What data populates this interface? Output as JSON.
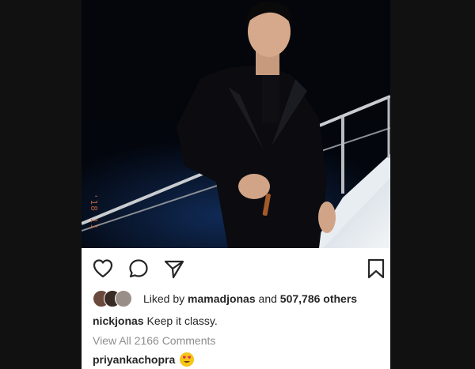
{
  "post": {
    "photo": {
      "description_icon": "photo-of-man-in-velvet-suit-icon",
      "date_stamp": "'18 11"
    },
    "actions": {
      "like_icon": "heart-icon",
      "comment_icon": "comment-bubble-icon",
      "share_icon": "paper-plane-icon",
      "save_icon": "bookmark-icon"
    },
    "likes": {
      "prefix": "Liked by",
      "user": "mamadjonas",
      "conjunction": "and",
      "count": "507,786 others"
    },
    "caption": {
      "user": "nickjonas",
      "text": "Keep it classy."
    },
    "view_all": "View All 2166 Comments",
    "comment": {
      "user": "priyankachopra",
      "emoji_icon": "heart-eyes-emoji-icon"
    }
  },
  "colors": {
    "background": "#111111",
    "text": "#262626",
    "muted": "#8e8e8e",
    "date_stamp": "#d06a3a"
  }
}
